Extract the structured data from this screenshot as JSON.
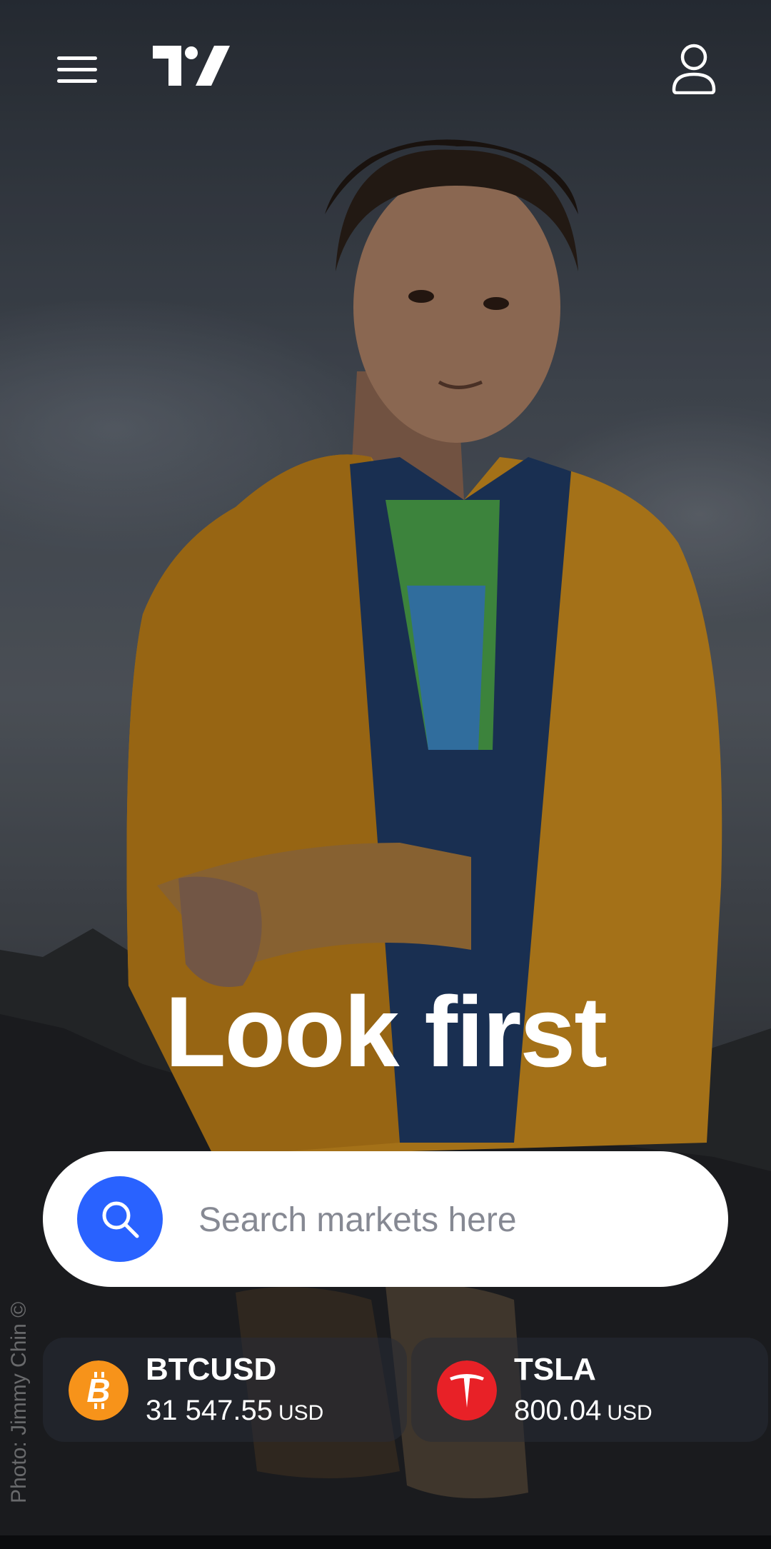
{
  "header": {
    "menu_icon": "hamburger-menu-icon",
    "logo_icon": "tradingview-logo-icon",
    "profile_icon": "user-profile-icon"
  },
  "hero": {
    "headline": "Look first",
    "photo_credit": "Photo: Jimmy Chin ©"
  },
  "search": {
    "placeholder": "Search markets here",
    "value": "",
    "icon": "search-icon",
    "button_color": "#2962ff"
  },
  "tickers": [
    {
      "symbol": "BTCUSD",
      "price": "31 547.55",
      "currency": "USD",
      "icon": "bitcoin-icon",
      "icon_color": "#f7931a"
    },
    {
      "symbol": "TSLA",
      "price": "800.04",
      "currency": "USD",
      "icon": "tesla-icon",
      "icon_color": "#e82127"
    }
  ]
}
